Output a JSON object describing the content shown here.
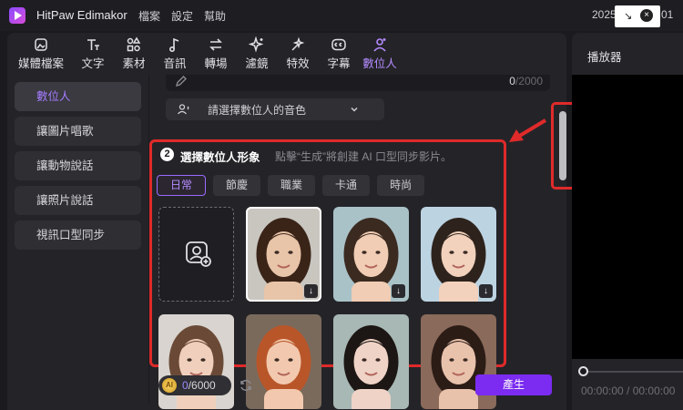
{
  "window": {
    "app_title": "HitPaw Edimakor",
    "menu": [
      "檔案",
      "設定",
      "幫助"
    ],
    "date_prefix": "2025",
    "date_suffix": "01"
  },
  "toolbar": {
    "items": [
      {
        "label": "媒體檔案",
        "icon": "media-icon"
      },
      {
        "label": "文字",
        "icon": "text-icon"
      },
      {
        "label": "素材",
        "icon": "elements-icon"
      },
      {
        "label": "音訊",
        "icon": "music-note-icon"
      },
      {
        "label": "轉場",
        "icon": "transition-icon"
      },
      {
        "label": "濾鏡",
        "icon": "filter-sparkle-icon"
      },
      {
        "label": "特效",
        "icon": "effects-icon"
      },
      {
        "label": "字幕",
        "icon": "subtitle-icon"
      },
      {
        "label": "數位人",
        "icon": "avatar-icon",
        "active": true
      }
    ]
  },
  "sidebar": {
    "items": [
      {
        "label": "數位人",
        "active": true
      },
      {
        "label": "讓圖片唱歌"
      },
      {
        "label": "讓動物說話"
      },
      {
        "label": "讓照片說話"
      },
      {
        "label": "視訊口型同步"
      }
    ]
  },
  "script_box": {
    "counter_used": "0",
    "counter_total": "/2000"
  },
  "voice_select": {
    "placeholder": "請選擇數位人的音色"
  },
  "avatar_section": {
    "step": "2",
    "title": "選擇數位人形象",
    "hint": "點擊“生成”將創建 AI 口型同步影片。",
    "tabs": [
      "日常",
      "節慶",
      "職業",
      "卡通",
      "時尚"
    ],
    "active_tab": "日常",
    "cards": [
      {
        "type": "add"
      },
      {
        "type": "avatar",
        "skin": "#e8c4a8",
        "hair": "#3a2418",
        "bg": "#c9c6c0",
        "downloadable": true,
        "selected": true
      },
      {
        "type": "avatar",
        "skin": "#f0cdb4",
        "hair": "#3b2a20",
        "bg": "#a9c2c8",
        "downloadable": true
      },
      {
        "type": "avatar",
        "skin": "#f2d2bd",
        "hair": "#2e231c",
        "bg": "#bcd3e2",
        "downloadable": true
      },
      {
        "type": "avatar",
        "skin": "#f0d0bc",
        "hair": "#6a4a36",
        "bg": "#d9d4cf"
      },
      {
        "type": "avatar",
        "skin": "#f2c9ae",
        "hair": "#b8562a",
        "bg": "#7a6a5c"
      },
      {
        "type": "avatar",
        "skin": "#efd3c6",
        "hair": "#1c1614",
        "bg": "#a8b8b4"
      },
      {
        "type": "avatar",
        "skin": "#e9c2ac",
        "hair": "#2b1c16",
        "bg": "#8a6a5a"
      }
    ]
  },
  "bottom_bar": {
    "coin_label": "AI",
    "credits_used": "0",
    "credits_total": "/6000",
    "generate_label": "產生"
  },
  "player": {
    "title": "播放器",
    "time": "00:00:00 / 00:00:00"
  },
  "colors": {
    "accent": "#7b2cf0",
    "highlight": "#e02a2a"
  }
}
